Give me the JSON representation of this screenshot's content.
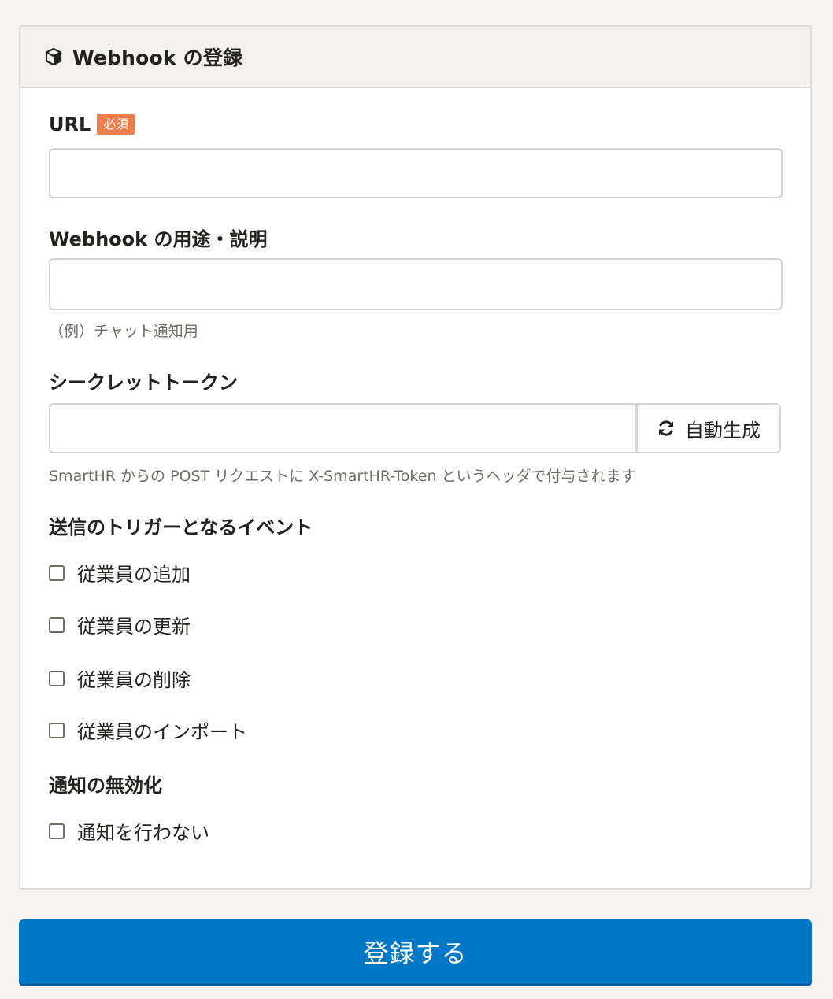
{
  "header": {
    "title": "Webhook の登録",
    "icon": "box-icon"
  },
  "url_field": {
    "label": "URL",
    "required_badge": "必須",
    "value": "",
    "placeholder": ""
  },
  "description_field": {
    "label": "Webhook の用途・説明",
    "value": "",
    "placeholder": "",
    "help": "（例）チャット通知用"
  },
  "token_field": {
    "label": "シークレットトークン",
    "value": "",
    "placeholder": "",
    "generate_label": "自動生成",
    "generate_icon": "refresh-icon",
    "help": "SmartHR からの POST リクエストに X-SmartHR-Token というヘッダで付与されます"
  },
  "triggers": {
    "label": "送信のトリガーとなるイベント",
    "options": [
      {
        "label": "従業員の追加",
        "checked": false
      },
      {
        "label": "従業員の更新",
        "checked": false
      },
      {
        "label": "従業員の削除",
        "checked": false
      },
      {
        "label": "従業員のインポート",
        "checked": false
      }
    ]
  },
  "disable_notifications": {
    "label": "通知の無効化",
    "option": {
      "label": "通知を行わない",
      "checked": false
    }
  },
  "submit": {
    "label": "登録する"
  },
  "colors": {
    "primary": "#0077c7",
    "required_badge": "#f07c4b",
    "header_bg": "#f2f1ef",
    "page_bg": "#f5f4f3"
  }
}
